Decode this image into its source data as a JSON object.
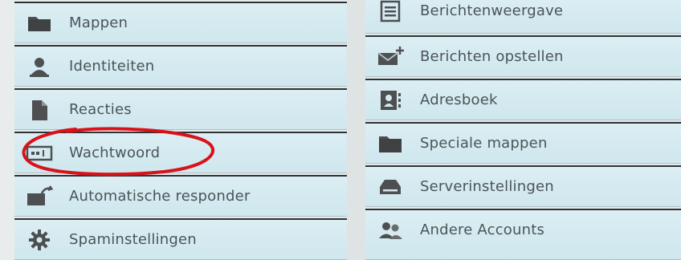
{
  "left_menu": {
    "items": [
      {
        "label": "Mappen",
        "icon": "folder-icon"
      },
      {
        "label": "Identiteiten",
        "icon": "user-icon"
      },
      {
        "label": "Reacties",
        "icon": "document-icon"
      },
      {
        "label": "Wachtwoord",
        "icon": "password-field-icon"
      },
      {
        "label": "Automatische responder",
        "icon": "auto-reply-icon"
      },
      {
        "label": "Spaminstellingen",
        "icon": "gear-icon"
      }
    ]
  },
  "right_menu": {
    "items": [
      {
        "label": "Berichtenweergave",
        "icon": "message-view-icon"
      },
      {
        "label": "Berichten opstellen",
        "icon": "compose-message-icon"
      },
      {
        "label": "Adresboek",
        "icon": "address-book-icon"
      },
      {
        "label": "Speciale mappen",
        "icon": "folder-icon"
      },
      {
        "label": "Serverinstellingen",
        "icon": "server-icon"
      },
      {
        "label": "Andere Accounts",
        "icon": "users-icon"
      }
    ]
  },
  "colors": {
    "item_background": "#d4eaf0",
    "item_border": "#2c3335",
    "label_text": "#4a5457",
    "icon": "#4d4f50",
    "highlight_ring": "#d9121a"
  }
}
